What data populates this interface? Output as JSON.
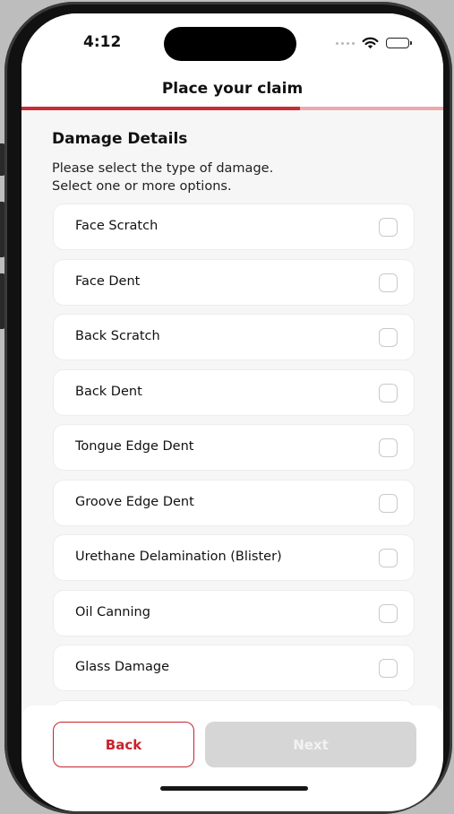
{
  "status_bar": {
    "time": "4:12"
  },
  "header": {
    "title": "Place your claim",
    "progress": 0.66
  },
  "section": {
    "title": "Damage Details",
    "instruction_line1": "Please select the type of damage.",
    "instruction_line2": "Select one or more options."
  },
  "options": [
    {
      "label": "Face Scratch",
      "checked": false
    },
    {
      "label": "Face Dent",
      "checked": false
    },
    {
      "label": "Back Scratch",
      "checked": false
    },
    {
      "label": "Back Dent",
      "checked": false
    },
    {
      "label": "Tongue Edge Dent",
      "checked": false
    },
    {
      "label": "Groove Edge Dent",
      "checked": false
    },
    {
      "label": "Urethane Delamination (Blister)",
      "checked": false
    },
    {
      "label": "Oil Canning",
      "checked": false
    },
    {
      "label": "Glass Damage",
      "checked": false
    }
  ],
  "footer": {
    "back_label": "Back",
    "next_label": "Next",
    "next_enabled": false
  },
  "colors": {
    "accent": "#c8232c",
    "progress_track": "#eba9ae",
    "disabled_button": "#d6d6d6"
  }
}
